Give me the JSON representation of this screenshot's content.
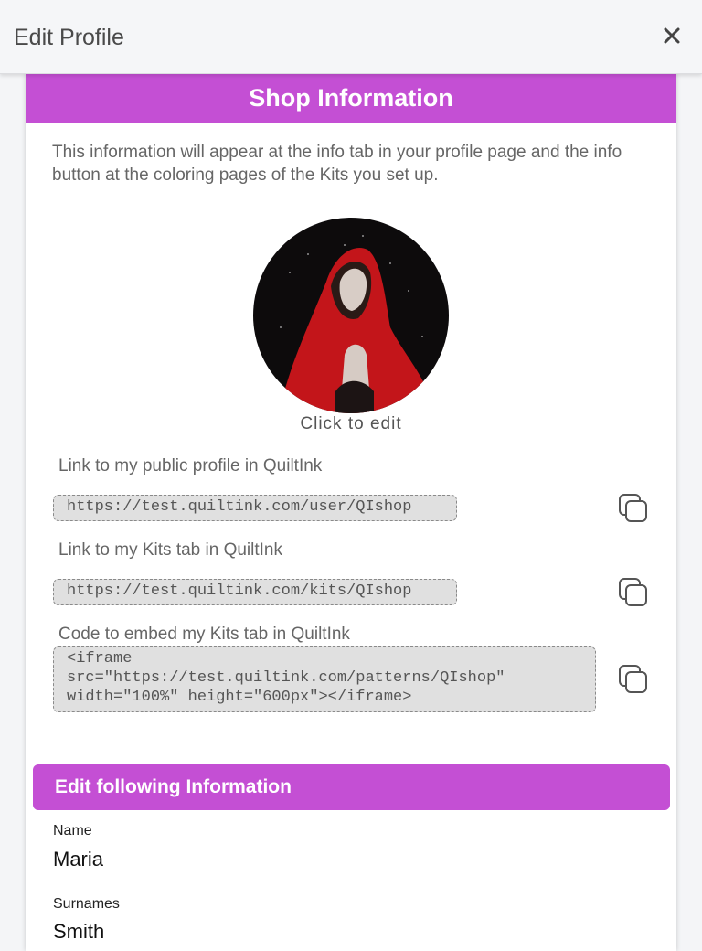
{
  "header": {
    "title": "Edit Profile",
    "close_icon": "close-icon"
  },
  "shop": {
    "title": "Shop Information",
    "description": "This information will appear at the info tab in your profile page and the info button at the coloring pages of the Kits you set up.",
    "avatar_caption": "Click to edit",
    "public_profile_label": "Link to my public profile in QuiltInk",
    "public_profile_url": "https://test.quiltink.com/user/QIshop",
    "kits_tab_label": "Link to my Kits tab in QuiltInk",
    "kits_tab_url": "https://test.quiltink.com/kits/QIshop",
    "embed_label": "Code to embed my Kits tab in QuiltInk",
    "embed_code": "<iframe\nsrc=\"https://test.quiltink.com/patterns/QIshop\"\nwidth=\"100%\" height=\"600px\"></iframe>"
  },
  "edit": {
    "title": "Edit following Information",
    "name_label": "Name",
    "name_value": "Maria",
    "surnames_label": "Surnames",
    "surnames_value": "Smith"
  },
  "colors": {
    "accent": "#c44fd4",
    "code_bg": "#e0e0e0"
  }
}
